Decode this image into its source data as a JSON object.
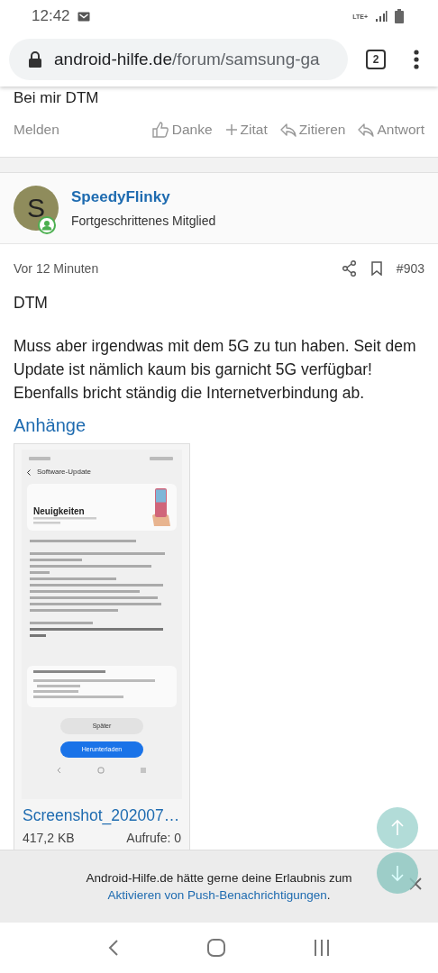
{
  "status_bar": {
    "time": "12:42",
    "network": "LTE+"
  },
  "browser": {
    "url_host": "android-hilfe.de",
    "url_path": "/forum/samsung-ga",
    "tab_count": "2"
  },
  "previous_post": {
    "text": "Bei mir DTM",
    "report": "Melden",
    "actions": [
      {
        "label": "Danke",
        "kind": "like"
      },
      {
        "label": "Zitat",
        "kind": "plus"
      },
      {
        "label": "Zitieren",
        "kind": "reply"
      },
      {
        "label": "Antwort",
        "kind": "reply"
      }
    ]
  },
  "post": {
    "author": {
      "initial": "S",
      "name": "SpeedyFlinky",
      "rank": "Fortgeschrittenes Mitglied",
      "online": true
    },
    "time": "Vor 12 Minuten",
    "number": "#903",
    "paragraphs": [
      "DTM",
      "Muss aber irgendwas mit dem 5G zu tun haben. Seit dem Update ist nämlich kaum bis garnicht 5G verfügbar! Ebenfalls bricht ständig die Internetverbindung ab."
    ],
    "attachments_title": "Anhänge",
    "attachment": {
      "screenshot": {
        "title": "Software-Update",
        "heading": "Neuigkeiten",
        "later": "Später",
        "download": "Herunterladen"
      },
      "name": "Screenshot_202007…",
      "size": "417,2 KB",
      "views": "Aufrufe: 0"
    }
  },
  "push_banner": {
    "text": "Android-Hilfe.de hätte gerne deine Erlaubnis zum ",
    "link": "Aktivieren von Push-Benachrichtigungen",
    "end": "."
  }
}
